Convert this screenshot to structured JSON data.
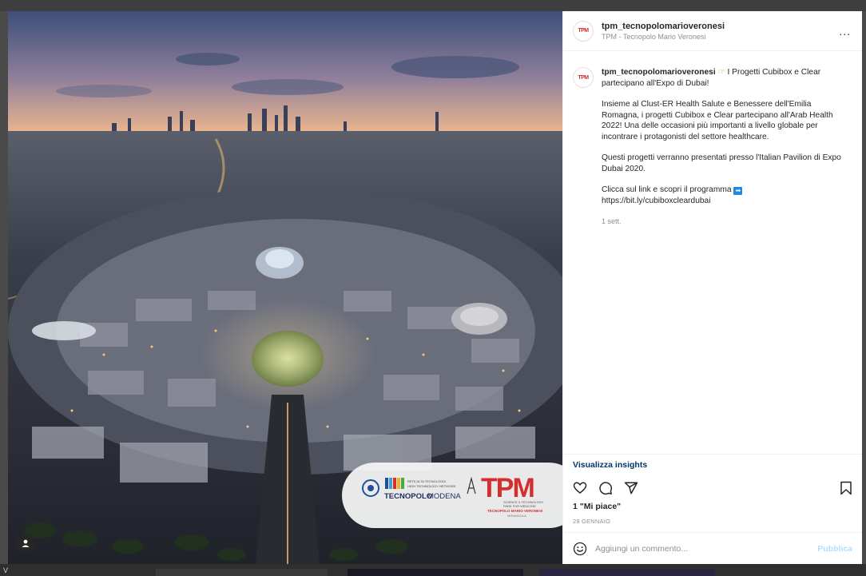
{
  "post": {
    "username": "tpm_tecnopolomarioveronesi",
    "location": "TPM - Tecnopolo Mario Veronesi",
    "avatar_text": "TPM",
    "more_label": "...",
    "caption": {
      "username": "tpm_tecnopolomarioveronesi",
      "title": "I Progetti Cubibox e Clear partecipano all'Expo di Dubai!",
      "para1": "Insieme al Clust-ER Health Salute e Benessere dell'Emilia Romagna, i progetti Cubibox e Clear partecipano all'Arab Health 2022! Una delle occasioni più importanti a livello globale per incontrare i protagonisti del settore healthcare.",
      "para2": "Questi progetti verranno presentati presso l'Italian Pavilion di Expo Dubai 2020.",
      "para3": "Clicca sul link e scopri il programma",
      "link": "https://bit.ly/cubiboxcleardubai",
      "time": "1 sett."
    },
    "insights_label": "Visualizza insights",
    "likes": "1 \"Mi piace\"",
    "date": "28 GENNAIO",
    "comment_placeholder": "Aggiungi un commento...",
    "publish_label": "Pubblica"
  },
  "image_overlay": {
    "left_logo_tagline_1": "RETE ALTA TECNOLOGIA",
    "left_logo_tagline_2": "HIGH TECHNOLOGY NETWORK",
    "left_logo_main": "TECNOPOLO",
    "left_logo_city": "MODENA",
    "right_logo": "TPM",
    "right_sub_1": "SCIENCE & TECHNOLOGY",
    "right_sub_2": "PARK FOR MEDICINE",
    "right_sub_3": "TECNOPOLO MARIO VERONESI",
    "right_sub_4": "MIRANDOLA"
  },
  "backdrop": {
    "corner_label": "V"
  },
  "icons": {
    "like": "heart-icon",
    "comment": "comment-icon",
    "share": "share-icon",
    "save": "bookmark-icon",
    "emoji": "smiley-icon",
    "tag": "user-tag-icon"
  },
  "colors": {
    "link": "#00376b",
    "publish_disabled": "#b2dffc",
    "brand_red": "#d32f2f"
  }
}
